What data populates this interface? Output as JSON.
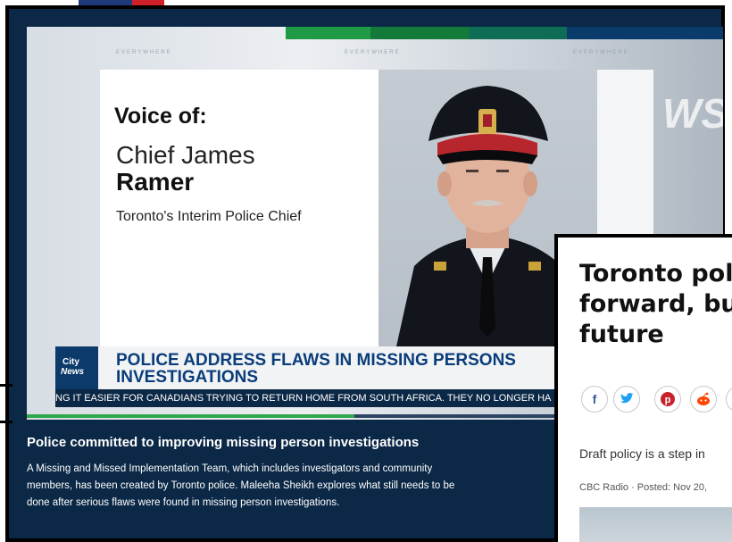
{
  "video": {
    "voice_label": "Voice of:",
    "chief_first": "Chief James",
    "chief_last": "Ramer",
    "chief_role": "Toronto's Interim Police Chief",
    "bg_words": [
      "EVERYWHERE",
      "EVERYWHERE",
      "EVERYWHERE"
    ],
    "bg_partial": "WS",
    "logo_city": "City",
    "logo_news": "News",
    "headline": "POLICE ADDRESS FLAWS IN MISSING PERSONS INVESTIGATIONS",
    "ticker": "NG IT EASIER FOR CANADIANS TRYING TO RETURN HOME FROM SOUTH AFRICA.  THEY NO LONGER HA",
    "progress_fraction": 0.47,
    "accent_green": "#2ea84a",
    "brand_navy": "#0b2846"
  },
  "caption": {
    "title": "Police committed to improving missing person investigations",
    "body": "A Missing and Missed Implementation Team, which includes investigators and community members, has been created by Toronto police. Maleeha Sheikh explores what still needs to be done after serious flaws were found in missing person investigations."
  },
  "article": {
    "title_line1": "Toronto pol",
    "title_line2": "forward, bu",
    "title_line3": "future",
    "share": {
      "facebook": "f",
      "twitter": "t",
      "pinterest": "p",
      "reddit": "r"
    },
    "deck": "Draft policy is a step in",
    "byline": "CBC Radio · Posted: Nov 20,"
  }
}
